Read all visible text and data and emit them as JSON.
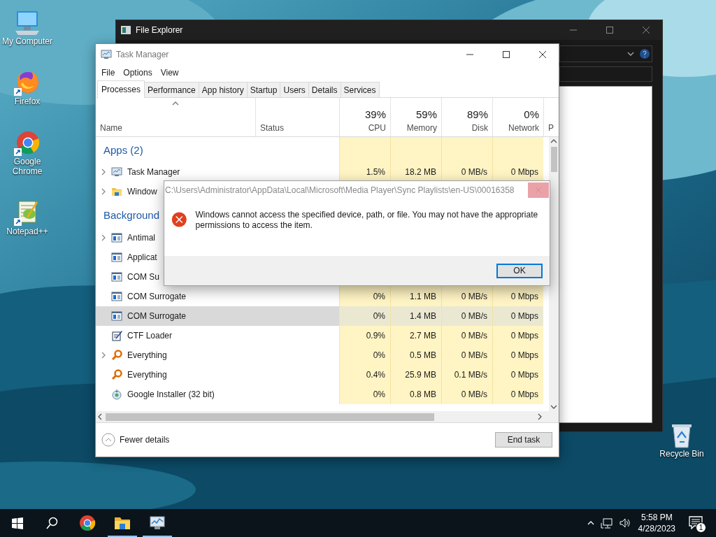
{
  "desktop": {
    "icons": [
      {
        "label": "My Computer",
        "kind": "computer"
      },
      {
        "label": "Firefox",
        "kind": "firefox"
      },
      {
        "label": "Google Chrome",
        "kind": "chrome"
      },
      {
        "label": "Notepad++",
        "kind": "notepad"
      }
    ],
    "recycle_bin": {
      "label": "Recycle Bin"
    }
  },
  "file_explorer": {
    "title": "File Explorer"
  },
  "task_manager": {
    "title": "Task Manager",
    "menu": [
      "File",
      "Options",
      "View"
    ],
    "tabs": [
      {
        "label": "Processes",
        "selected": true
      },
      {
        "label": "Performance",
        "selected": false
      },
      {
        "label": "App history",
        "selected": false
      },
      {
        "label": "Startup",
        "selected": false
      },
      {
        "label": "Users",
        "selected": false
      },
      {
        "label": "Details",
        "selected": false
      },
      {
        "label": "Services",
        "selected": false
      }
    ],
    "columns": [
      {
        "label": "Name"
      },
      {
        "label": "Status"
      },
      {
        "total": "39%",
        "label": "CPU"
      },
      {
        "total": "59%",
        "label": "Memory"
      },
      {
        "total": "89%",
        "label": "Disk"
      },
      {
        "total": "0%",
        "label": "Network"
      },
      {
        "label": "P"
      }
    ],
    "groups": [
      {
        "label": "Apps (2)",
        "rows": [
          {
            "kind": "taskmgr",
            "name": "Task Manager",
            "expandable": true,
            "selected": false,
            "cpu": "1.5%",
            "memory": "18.2 MB",
            "disk": "0 MB/s",
            "network": "0 Mbps"
          },
          {
            "kind": "explorer",
            "name": "Window",
            "expandable": true,
            "selected": false
          }
        ]
      },
      {
        "label": "Background",
        "rows": [
          {
            "kind": "service",
            "name": "Antimal",
            "expandable": true,
            "selected": false
          },
          {
            "kind": "service",
            "name": "Applicat",
            "expandable": false,
            "selected": false
          },
          {
            "kind": "service",
            "name": "COM Su",
            "expandable": false,
            "selected": false
          },
          {
            "kind": "service",
            "name": "COM Surrogate",
            "expandable": false,
            "selected": false,
            "cpu": "0%",
            "memory": "1.1 MB",
            "disk": "0 MB/s",
            "network": "0 Mbps"
          },
          {
            "kind": "service",
            "name": "COM Surrogate",
            "expandable": false,
            "selected": true,
            "cpu": "0%",
            "memory": "1.4 MB",
            "disk": "0 MB/s",
            "network": "0 Mbps"
          },
          {
            "kind": "ctf",
            "name": "CTF Loader",
            "expandable": false,
            "selected": false,
            "cpu": "0.9%",
            "memory": "2.7 MB",
            "disk": "0 MB/s",
            "network": "0 Mbps"
          },
          {
            "kind": "everything",
            "name": "Everything",
            "expandable": true,
            "selected": false,
            "cpu": "0%",
            "memory": "0.5 MB",
            "disk": "0 MB/s",
            "network": "0 Mbps"
          },
          {
            "kind": "everything",
            "name": "Everything",
            "expandable": false,
            "selected": false,
            "cpu": "0.4%",
            "memory": "25.9 MB",
            "disk": "0.1 MB/s",
            "network": "0 Mbps"
          },
          {
            "kind": "installer",
            "name": "Google Installer (32 bit)",
            "expandable": false,
            "selected": false,
            "cpu": "0%",
            "memory": "0.8 MB",
            "disk": "0 MB/s",
            "network": "0 Mbps"
          }
        ]
      }
    ],
    "fewer_details": "Fewer details",
    "end_task": "End task"
  },
  "dialog": {
    "title": "C:\\Users\\Administrator\\AppData\\Local\\Microsoft\\Media Player\\Sync Playlists\\en-US\\00016358",
    "message": "Windows cannot access the specified device, path, or file. You may not have the appropriate permissions to access the item.",
    "ok": "OK"
  },
  "taskbar": {
    "apps": [
      {
        "kind": "chrome",
        "running": false
      },
      {
        "kind": "folder",
        "running": true
      },
      {
        "kind": "taskmgr",
        "running": true
      }
    ],
    "time": "5:58 PM",
    "date": "4/28/2023",
    "notification_count": "1"
  }
}
